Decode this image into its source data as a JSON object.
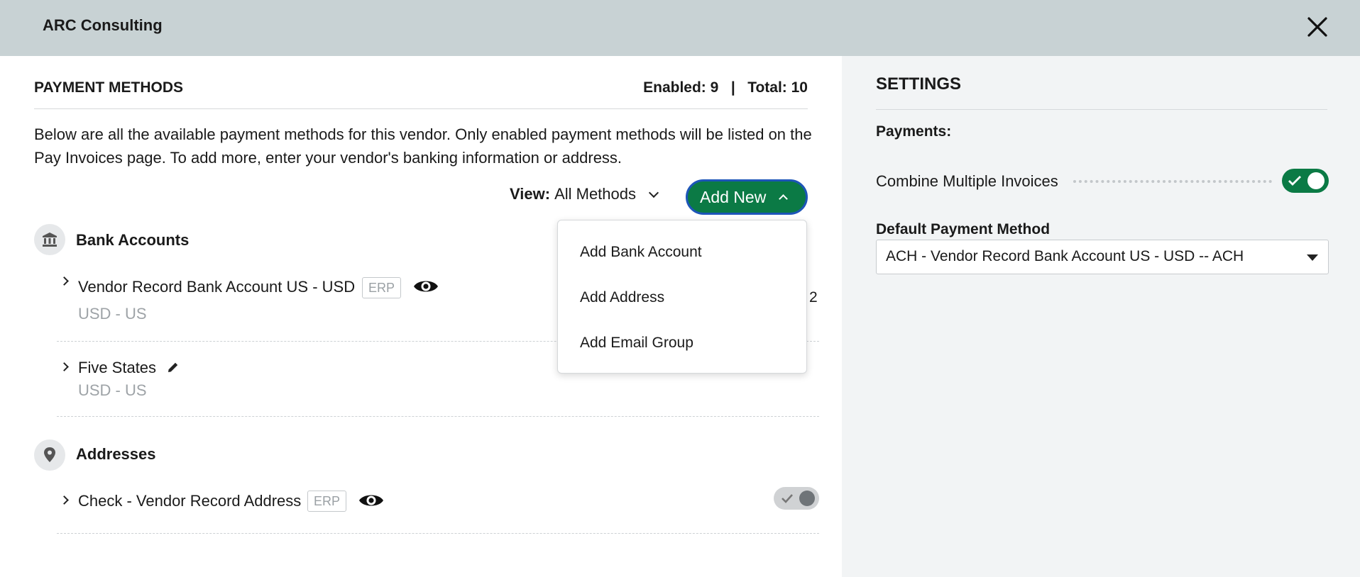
{
  "header": {
    "title": "ARC Consulting",
    "close_icon": "close-icon"
  },
  "payment_methods": {
    "title": "PAYMENT METHODS",
    "counts": "Enabled: 9   |   Total: 10",
    "description": "Below are all the available payment methods for this vendor. Only enabled payment methods will be listed on the Pay Invoices page. To add more, enter your vendor's banking information or address.",
    "view_label": "View:",
    "view_value": "All Methods",
    "add_new_label": "Add New",
    "add_menu": [
      "Add Bank Account",
      "Add Address",
      "Add Email Group"
    ],
    "bank_section": {
      "title": "Bank Accounts",
      "icon": "bank-icon",
      "items": [
        {
          "name": "Vendor Record Bank Account US - USD",
          "badge": "ERP",
          "sub": "USD - US",
          "icon": "eye-icon",
          "trailing": "2"
        },
        {
          "name": "Five States",
          "sub": "USD - US",
          "icon": "pencil-icon"
        }
      ]
    },
    "address_section": {
      "title": "Addresses",
      "icon": "location-pin-icon",
      "items": [
        {
          "name": "Check - Vendor Record Address",
          "badge": "ERP",
          "icon": "eye-icon",
          "enabled": false
        }
      ]
    }
  },
  "settings": {
    "title": "SETTINGS",
    "payments_label": "Payments:",
    "combine_label": "Combine Multiple Invoices",
    "combine_enabled": true,
    "default_method_label": "Default Payment Method",
    "default_method_value": "ACH - Vendor Record Bank Account US - USD -- ACH"
  },
  "colors": {
    "accent_green": "#0b7a45",
    "header_bg": "#c8d2d4",
    "focus_blue": "#1d55b8"
  }
}
